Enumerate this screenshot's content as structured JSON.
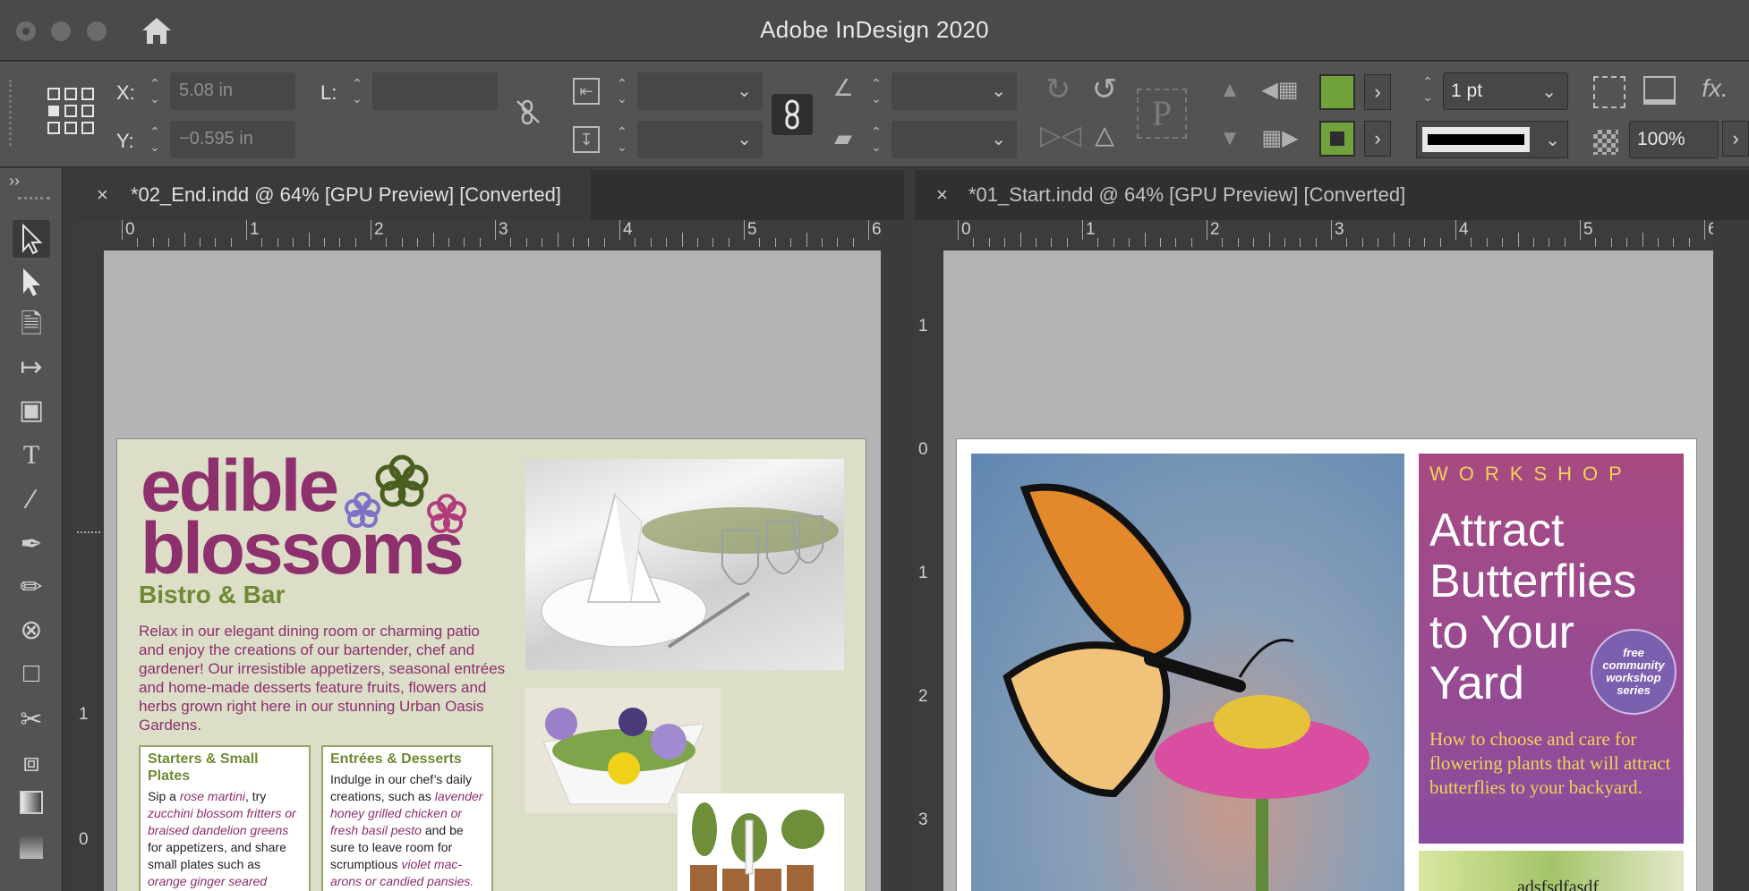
{
  "window": {
    "title": "Adobe InDesign 2020"
  },
  "control": {
    "x_label": "X:",
    "x_value": "5.08 in",
    "y_label": "Y:",
    "y_value": "−0.595 in",
    "l_label": "L:",
    "stroke_weight": "1 pt",
    "opacity": "100%"
  },
  "colors": {
    "fill_swatch": "#71a13a",
    "stroke_swatch": "#71a13a"
  },
  "tabs": [
    {
      "title": "*02_End.indd @ 64% [GPU Preview] [Converted]",
      "close": "×"
    },
    {
      "title": "*01_Start.indd @ 64% [GPU Preview] [Converted]",
      "close": "×"
    }
  ],
  "rulers": {
    "left_h": [
      "0",
      "1",
      "2",
      "3",
      "4",
      "5",
      "6"
    ],
    "right_h": [
      "0",
      "1",
      "2",
      "3",
      "4",
      "5",
      "6"
    ],
    "left_v": [
      "1",
      "0"
    ],
    "right_v": [
      "1",
      "0",
      "1",
      "2",
      "3"
    ]
  },
  "doc1": {
    "title_line1": "edible",
    "title_line2": "blossoms",
    "subtitle": "Bistro & Bar",
    "intro": "Relax in our elegant dining room or charming patio and enjoy the creations of our bartender, chef and gardener! Our irresistible appetizers, seasonal entrées and home-made desserts feature fruits, flowers and herbs grown right here in our stunning Urban Oasis Gardens.",
    "box1_title": "Starters & Small Plates",
    "box1_t1": "Sip a ",
    "box1_i1": "rose martini",
    "box1_t2": ", try ",
    "box1_i2": "zucchini blossom fritters or braised dandelion greens",
    "box1_t3": " for appetizers, and share small plates such as ",
    "box1_i3": "orange ginger seared scallops or chive flower flatbread.",
    "box2_title": "Entrées & Desserts",
    "box2_t1": "Indulge in our chef’s daily creations, such as ",
    "box2_i1": "lavender honey grilled chicken or fresh basil pesto",
    "box2_t2": " and be sure to leave room for scrumptious ",
    "box2_i2": "violet mac-arons or candied pansies."
  },
  "doc2": {
    "workshop": "WORKSHOP",
    "headline": [
      "Attract",
      "Butterflies",
      "to Your",
      "Yard"
    ],
    "badge": [
      "free",
      "community",
      "workshop",
      "series"
    ],
    "subhead": "How to choose and care for flowering plants that will attract butterflies to your backyard.",
    "photo_caption": "adsfsdfasdf"
  }
}
